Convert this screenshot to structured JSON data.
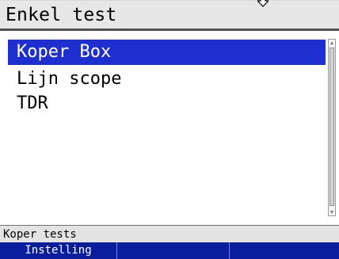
{
  "header": {
    "title": "Enkel test",
    "arrow_icon": "down-arrow-icon"
  },
  "menu": {
    "items": [
      {
        "label": "Koper Box",
        "selected": true
      },
      {
        "label": "Lijn scope",
        "selected": false
      },
      {
        "label": "TDR",
        "selected": false
      }
    ]
  },
  "status": {
    "text": "Koper tests"
  },
  "softkeys": [
    {
      "label": "Instelling"
    },
    {
      "label": ""
    },
    {
      "label": ""
    }
  ],
  "colors": {
    "selection": "#1f2fcf",
    "softkey_bar": "#0a1d9a",
    "header_bg": "#e7e7e7"
  }
}
